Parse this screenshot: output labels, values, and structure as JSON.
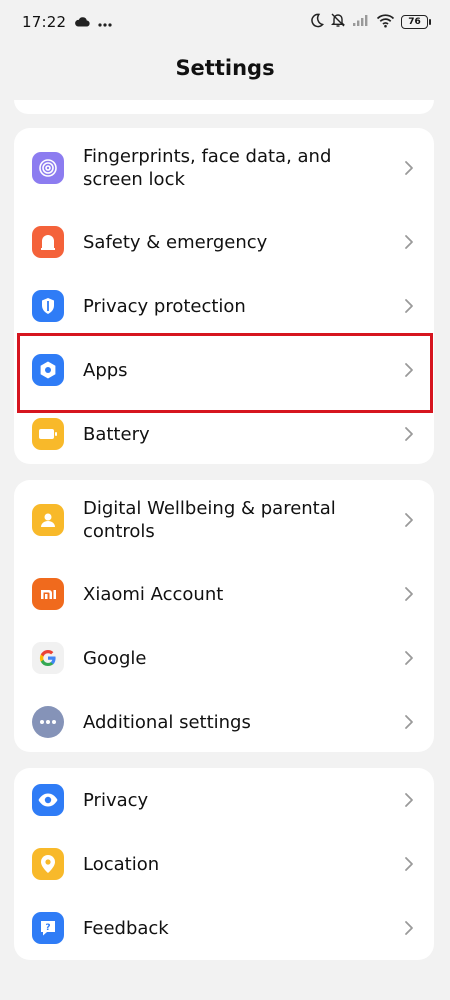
{
  "status": {
    "time": "17:22",
    "battery": "76",
    "colors": {
      "text": "#111111"
    }
  },
  "header": {
    "title": "Settings"
  },
  "groups": [
    {
      "items": [
        {
          "label": "Fingerprints, face data, and screen lock",
          "icon": "fingerprint-icon",
          "color": "#8c7cf0"
        },
        {
          "label": "Safety & emergency",
          "icon": "safety-alarm-icon",
          "color": "#f4623a"
        },
        {
          "label": "Privacy protection",
          "icon": "privacy-shield-icon",
          "color": "#2f7cf6"
        },
        {
          "label": "Apps",
          "icon": "apps-hexagon-icon",
          "color": "#2f7cf6",
          "highlighted": true
        },
        {
          "label": "Battery",
          "icon": "battery-icon",
          "color": "#f8b92a"
        }
      ]
    },
    {
      "items": [
        {
          "label": "Digital Wellbeing & parental controls",
          "icon": "wellbeing-icon",
          "color": "#f8b92a"
        },
        {
          "label": "Xiaomi Account",
          "icon": "xiaomi-logo-icon",
          "color": "#f06a1d"
        },
        {
          "label": "Google",
          "icon": "google-g-icon",
          "color": "#f1f1f1"
        },
        {
          "label": "Additional settings",
          "icon": "more-dots-icon",
          "color": "#8593b8"
        }
      ]
    },
    {
      "items": [
        {
          "label": "Privacy",
          "icon": "eye-icon",
          "color": "#2f7cf6"
        },
        {
          "label": "Location",
          "icon": "location-pin-icon",
          "color": "#f8b92a"
        },
        {
          "label": "Feedback",
          "icon": "feedback-icon",
          "color": "#2f7cf6"
        }
      ]
    }
  ],
  "highlight": {
    "color": "#d6151f",
    "target": "Apps"
  }
}
